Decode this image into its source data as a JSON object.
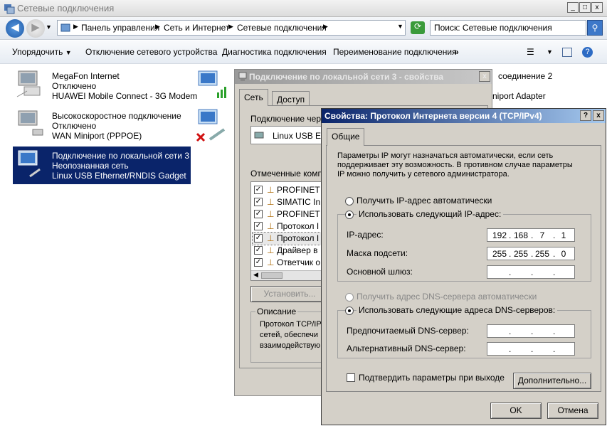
{
  "window": {
    "title": "Сетевые подключения",
    "min": "_",
    "max": "□",
    "close": "x"
  },
  "address": {
    "crumbs": [
      "Панель управления",
      "Сеть и Интернет",
      "Сетевые подключения"
    ],
    "search_placeholder": "Поиск: Сетевые подключения"
  },
  "toolbar": {
    "organize": "Упорядочить",
    "disable": "Отключение сетевого устройства",
    "diagnose": "Диагностика подключения",
    "rename": "Переименование подключения",
    "more": "»"
  },
  "connections": [
    {
      "name": "MegaFon Internet",
      "status": "Отключено",
      "device": "HUAWEI Mobile Connect - 3G Modem"
    },
    {
      "name": "Высокоскоростное подключение",
      "status": "Отключено",
      "device": "WAN Miniport (PPPOE)"
    },
    {
      "name": "Подключение по локальной сети 3",
      "status": "Неопознанная сеть",
      "device": "Linux USB Ethernet/RNDIS Gadget"
    }
  ],
  "right_items": {
    "conn2": "соединение 2",
    "adapter": "niport Adapter"
  },
  "dialog1": {
    "title": "Подключение по локальной сети 3 - свойства",
    "close": "x",
    "tabs": [
      "Сеть",
      "Доступ"
    ],
    "connect_via": "Подключение через:",
    "adapter": "Linux USB Eth",
    "components_label": "Отмеченные компо",
    "components": [
      "PROFINET",
      "SIMATIC In",
      "PROFINET",
      "Протокол I",
      "Протокол I",
      "Драйвер в",
      "Ответчик о"
    ],
    "install": "Установить...",
    "desc_title": "Описание",
    "desc": [
      "Протокол TCP/IP",
      "сетей, обеспечи",
      "взаимодействую"
    ]
  },
  "dialog2": {
    "title": "Свойства: Протокол Интернета версии 4 (TCP/IPv4)",
    "help": "?",
    "close": "x",
    "tab": "Общие",
    "info": [
      "Параметры IP могут назначаться автоматически, если сеть",
      "поддерживает эту возможность. В противном случае параметры",
      "IP можно получить у сетевого администратора."
    ],
    "auto_ip": "Получить IP-адрес автоматически",
    "manual_ip": "Использовать следующий IP-адрес:",
    "ip_label": "IP-адрес:",
    "ip": [
      "192",
      "168",
      "7",
      "1"
    ],
    "mask_label": "Маска подсети:",
    "mask": [
      "255",
      "255",
      "255",
      "0"
    ],
    "gateway_label": "Основной шлюз:",
    "auto_dns": "Получить адрес DNS-сервера автоматически",
    "manual_dns": "Использовать следующие адреса DNS-серверов:",
    "pref_dns_label": "Предпочитаемый DNS-сервер:",
    "alt_dns_label": "Альтернативный DNS-сервер:",
    "confirm": "Подтвердить параметры при выходе",
    "advanced": "Дополнительно...",
    "ok": "OK",
    "cancel": "Отмена"
  }
}
